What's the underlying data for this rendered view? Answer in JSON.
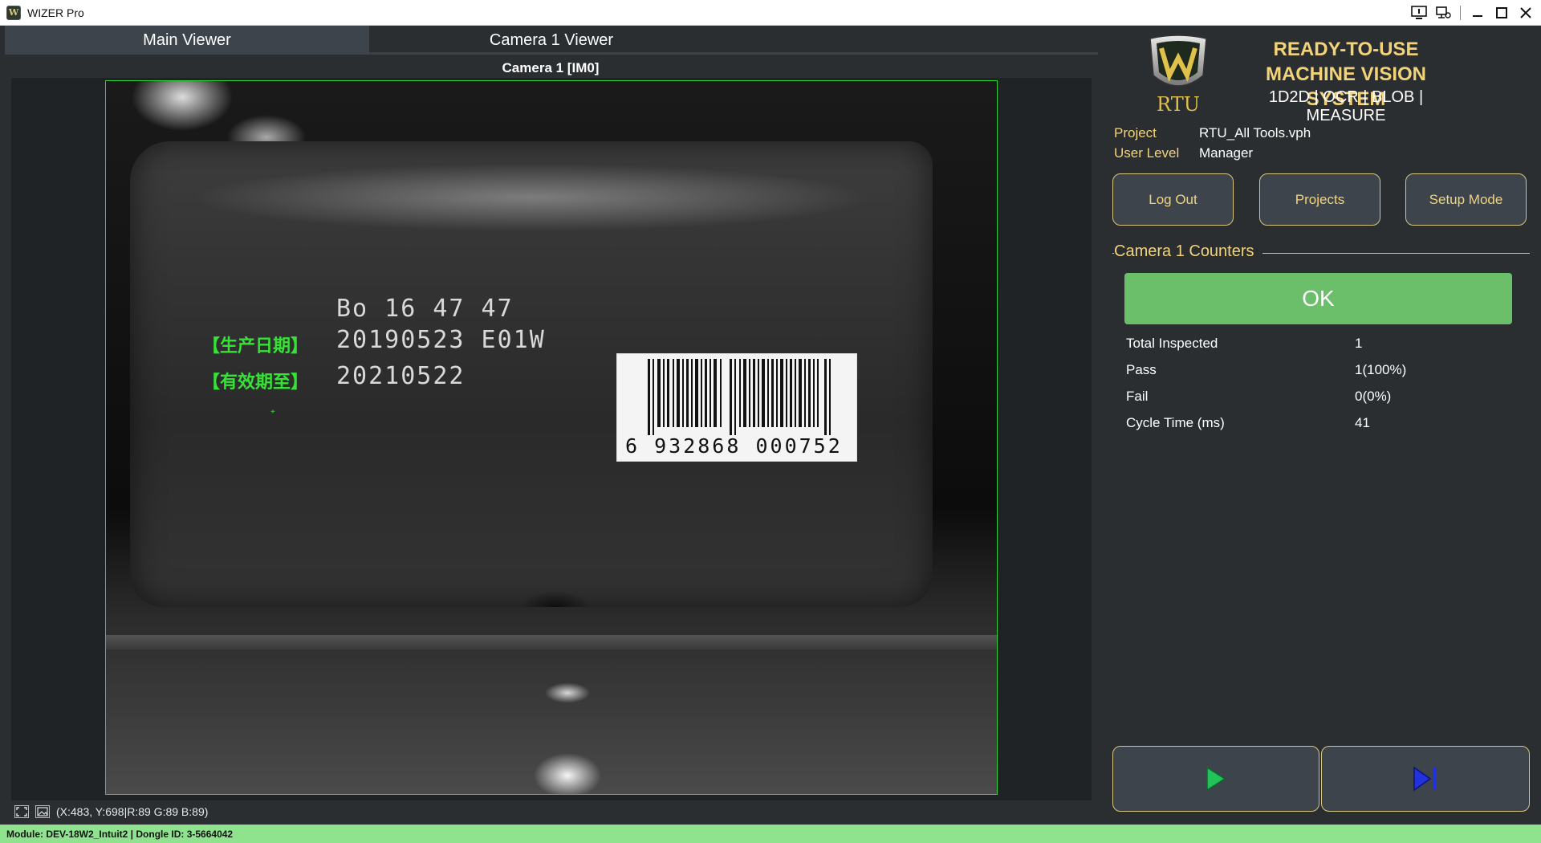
{
  "window": {
    "title": "WIZER Pro",
    "icon": "wizer-app-icon"
  },
  "tabs": [
    {
      "label": "Main Viewer",
      "active": true
    },
    {
      "label": "Camera 1 Viewer",
      "active": false
    }
  ],
  "viewer": {
    "camera_title": "Camera 1  [IM0]",
    "print_line1": "Bo   16 47 47",
    "print_line2": "20190523 E01W",
    "print_line3": "20210522",
    "ocr_label1": "【生产日期】",
    "ocr_label2": "【有效期至】",
    "barcode_digits": "6 932868 000752",
    "pixel_readout": "(X:483, Y:698|R:89 G:89 B:89)"
  },
  "header": {
    "logo_text": "RTU",
    "line1": "READY-TO-USE",
    "line2": "MACHINE VISION SYSTEM",
    "tools": "1D2D | OCR | BLOB | MEASURE"
  },
  "info": {
    "project_label": "Project",
    "project_value": "RTU_All Tools.vph",
    "user_label": "User Level",
    "user_value": "Manager"
  },
  "buttons": {
    "logout": "Log Out",
    "projects": "Projects",
    "setup": "Setup Mode"
  },
  "counters": {
    "title": "Camera 1 Counters",
    "status": "OK",
    "rows": [
      {
        "label": "Total Inspected",
        "value": "1"
      },
      {
        "label": "Pass",
        "value": "1(100%)"
      },
      {
        "label": "Fail",
        "value": "0(0%)"
      },
      {
        "label": "Cycle Time (ms)",
        "value": "41"
      }
    ]
  },
  "status_bar": {
    "text": "Module: DEV-18W2_Intuit2 | Dongle ID: 3-5664042"
  },
  "colors": {
    "accent": "#f2d37a",
    "ok": "#6bbf6b",
    "status_bar": "#8fe38f",
    "roi": "#2fd22f",
    "play": "#22c45a",
    "step": "#2233dd"
  }
}
